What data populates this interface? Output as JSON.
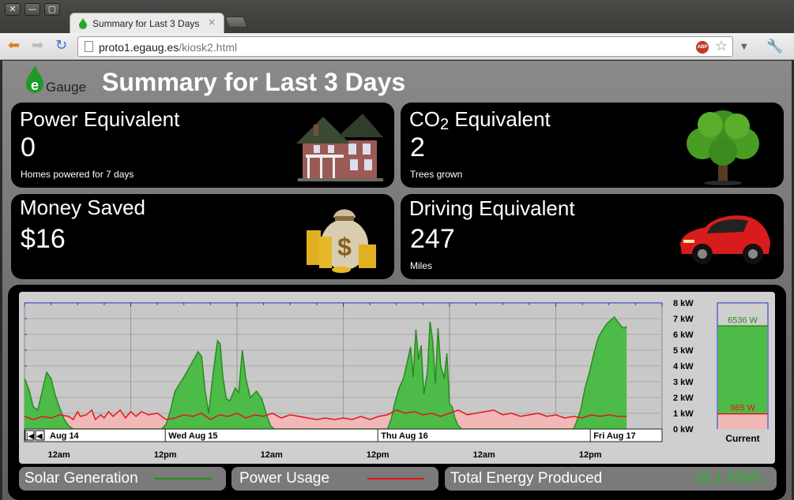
{
  "browser": {
    "window_buttons": [
      "✕",
      "—",
      "▢"
    ],
    "tab_title": "Summary for Last 3 Days",
    "tab_close": "×",
    "url_host": "proto1.egaug.es",
    "url_path": "/kiosk2.html",
    "abp_label": "ABP"
  },
  "header": {
    "logo_letter": "e",
    "logo_text": "Gauge",
    "title": "Summary for Last 3 Days"
  },
  "cards": {
    "power": {
      "title": "Power Equivalent",
      "value": "0",
      "caption": "Homes powered for 7 days"
    },
    "co2": {
      "title_prefix": "CO",
      "title_sub": "2",
      "title_suffix": " Equivalent",
      "value": "2",
      "caption": "Trees grown"
    },
    "money": {
      "title": "Money Saved",
      "value": "$16"
    },
    "driving": {
      "title": "Driving Equivalent",
      "value": "247",
      "caption": "Miles"
    }
  },
  "footer": {
    "solar_label": "Solar Generation",
    "usage_label": "Power Usage",
    "energy_label": "Total Energy Produced",
    "energy_value": "38.1 MWh"
  },
  "colors": {
    "solar": "#2a8a1e",
    "solar_fill": "#4cbb47",
    "usage": "#e8141c",
    "usage_fill": "#f2b8b8",
    "energy_value": "#2db52d"
  },
  "chart_data": {
    "type": "area",
    "y_unit": "kW",
    "y_ticks": [
      "8 kW",
      "7 kW",
      "6 kW",
      "5 kW",
      "4 kW",
      "3 kW",
      "2 kW",
      "1 kW",
      "0 kW"
    ],
    "ylim": [
      0,
      8
    ],
    "x_day_labels": [
      "Aug 14",
      "Wed Aug 15",
      "Thu Aug 16",
      "Fri Aug 17"
    ],
    "x_time_labels": [
      "12am",
      "12pm",
      "12am",
      "12pm",
      "12am",
      "12pm"
    ],
    "x_hours_shown": [
      0,
      72
    ],
    "series": [
      {
        "name": "Solar Generation",
        "points": [
          [
            0,
            3.2
          ],
          [
            0.5,
            2.5
          ],
          [
            1,
            1.4
          ],
          [
            1.5,
            1.2
          ],
          [
            2,
            2.4
          ],
          [
            2.5,
            3.6
          ],
          [
            3,
            3.2
          ],
          [
            3.5,
            2.1
          ],
          [
            4,
            1.3
          ],
          [
            4.5,
            0.6
          ],
          [
            5,
            0.2
          ],
          [
            5.5,
            0
          ],
          [
            15.5,
            0
          ],
          [
            16,
            0.3
          ],
          [
            16.5,
            1.2
          ],
          [
            17,
            2.4
          ],
          [
            18,
            3.3
          ],
          [
            19,
            4.3
          ],
          [
            19.6,
            4.9
          ],
          [
            20,
            4.6
          ],
          [
            20.4,
            2.4
          ],
          [
            20.8,
            1.0
          ],
          [
            21.3,
            3.5
          ],
          [
            21.8,
            5.6
          ],
          [
            22.1,
            5.4
          ],
          [
            22.4,
            3.3
          ],
          [
            22.8,
            1.9
          ],
          [
            23.2,
            1.8
          ],
          [
            23.8,
            2.6
          ],
          [
            24.2,
            2.3
          ],
          [
            24.6,
            5.0
          ],
          [
            25,
            3.2
          ],
          [
            25.5,
            2.0
          ],
          [
            26.2,
            2.4
          ],
          [
            26.8,
            1.9
          ],
          [
            27.4,
            0.8
          ],
          [
            27.8,
            0.2
          ],
          [
            28.2,
            0
          ],
          [
            41,
            0
          ],
          [
            41.4,
            0.6
          ],
          [
            41.8,
            1.6
          ],
          [
            42.3,
            2.6
          ],
          [
            42.8,
            3.2
          ],
          [
            43.2,
            4.2
          ],
          [
            43.6,
            5.2
          ],
          [
            43.9,
            3.3
          ],
          [
            44.2,
            6.3
          ],
          [
            44.5,
            4.4
          ],
          [
            44.8,
            5.3
          ],
          [
            45.1,
            2.2
          ],
          [
            45.5,
            3.6
          ],
          [
            45.8,
            6.8
          ],
          [
            46.1,
            5.6
          ],
          [
            46.4,
            2.9
          ],
          [
            46.7,
            6.4
          ],
          [
            47,
            4.0
          ],
          [
            47.4,
            3.2
          ],
          [
            47.7,
            4.8
          ],
          [
            48,
            1.6
          ],
          [
            48.3,
            1.4
          ],
          [
            48.6,
            0.7
          ],
          [
            49,
            0.2
          ],
          [
            49.4,
            0
          ],
          [
            62,
            0
          ],
          [
            62.3,
            0.4
          ],
          [
            62.8,
            1.2
          ],
          [
            63.3,
            2.6
          ],
          [
            63.8,
            3.6
          ],
          [
            64.3,
            4.8
          ],
          [
            64.8,
            5.8
          ],
          [
            65.3,
            6.3
          ],
          [
            65.8,
            6.7
          ],
          [
            66.2,
            6.9
          ],
          [
            66.6,
            7.1
          ],
          [
            67,
            6.8
          ],
          [
            67.4,
            6.5
          ],
          [
            67.7,
            6.4
          ],
          [
            68,
            6.5
          ]
        ]
      },
      {
        "name": "Power Usage",
        "points": [
          [
            0,
            0.8
          ],
          [
            1,
            0.6
          ],
          [
            2,
            0.8
          ],
          [
            3,
            0.7
          ],
          [
            4,
            0.9
          ],
          [
            5,
            0.8
          ],
          [
            5.5,
            0.6
          ],
          [
            6,
            1.1
          ],
          [
            6.3,
            0.8
          ],
          [
            7,
            0.9
          ],
          [
            7.6,
            1.2
          ],
          [
            8,
            0.6
          ],
          [
            8.6,
            0.9
          ],
          [
            9,
            0.7
          ],
          [
            9.5,
            1.1
          ],
          [
            10,
            0.8
          ],
          [
            10.8,
            1.2
          ],
          [
            11.4,
            0.7
          ],
          [
            12,
            1.1
          ],
          [
            12.6,
            0.8
          ],
          [
            13.2,
            1.1
          ],
          [
            14,
            0.9
          ],
          [
            15,
            1.0
          ],
          [
            16,
            0.6
          ],
          [
            17,
            0.7
          ],
          [
            18,
            0.9
          ],
          [
            19,
            0.8
          ],
          [
            20,
            1.0
          ],
          [
            21,
            0.6
          ],
          [
            22,
            0.9
          ],
          [
            23,
            0.8
          ],
          [
            24,
            1.0
          ],
          [
            25,
            0.7
          ],
          [
            26,
            0.9
          ],
          [
            27,
            0.8
          ],
          [
            28,
            1.0
          ],
          [
            29,
            0.7
          ],
          [
            30,
            0.9
          ],
          [
            31,
            0.8
          ],
          [
            32,
            0.7
          ],
          [
            33,
            0.6
          ],
          [
            34,
            0.7
          ],
          [
            35,
            0.6
          ],
          [
            36,
            0.7
          ],
          [
            37,
            0.6
          ],
          [
            38,
            0.8
          ],
          [
            39,
            0.6
          ],
          [
            40,
            0.8
          ],
          [
            41,
            0.9
          ],
          [
            42,
            1.2
          ],
          [
            43,
            1.0
          ],
          [
            44,
            1.1
          ],
          [
            45,
            0.9
          ],
          [
            46,
            1.0
          ],
          [
            47,
            0.8
          ],
          [
            48,
            1.0
          ],
          [
            49,
            1.2
          ],
          [
            50,
            0.9
          ],
          [
            51,
            1.0
          ],
          [
            52,
            1.1
          ],
          [
            53,
            1.2
          ],
          [
            54,
            0.9
          ],
          [
            55,
            1.0
          ],
          [
            56,
            0.8
          ],
          [
            57,
            0.9
          ],
          [
            58,
            1.0
          ],
          [
            59,
            0.8
          ],
          [
            60,
            0.9
          ],
          [
            61,
            0.7
          ],
          [
            62,
            0.8
          ],
          [
            63,
            0.7
          ],
          [
            64,
            0.9
          ],
          [
            65,
            0.8
          ],
          [
            66,
            0.9
          ],
          [
            67,
            0.8
          ],
          [
            68,
            0.8
          ]
        ]
      }
    ],
    "current": {
      "label": "Current",
      "solar": "6536 W",
      "usage": "965 W",
      "solar_kw": 6.536,
      "usage_kw": 0.965
    }
  }
}
